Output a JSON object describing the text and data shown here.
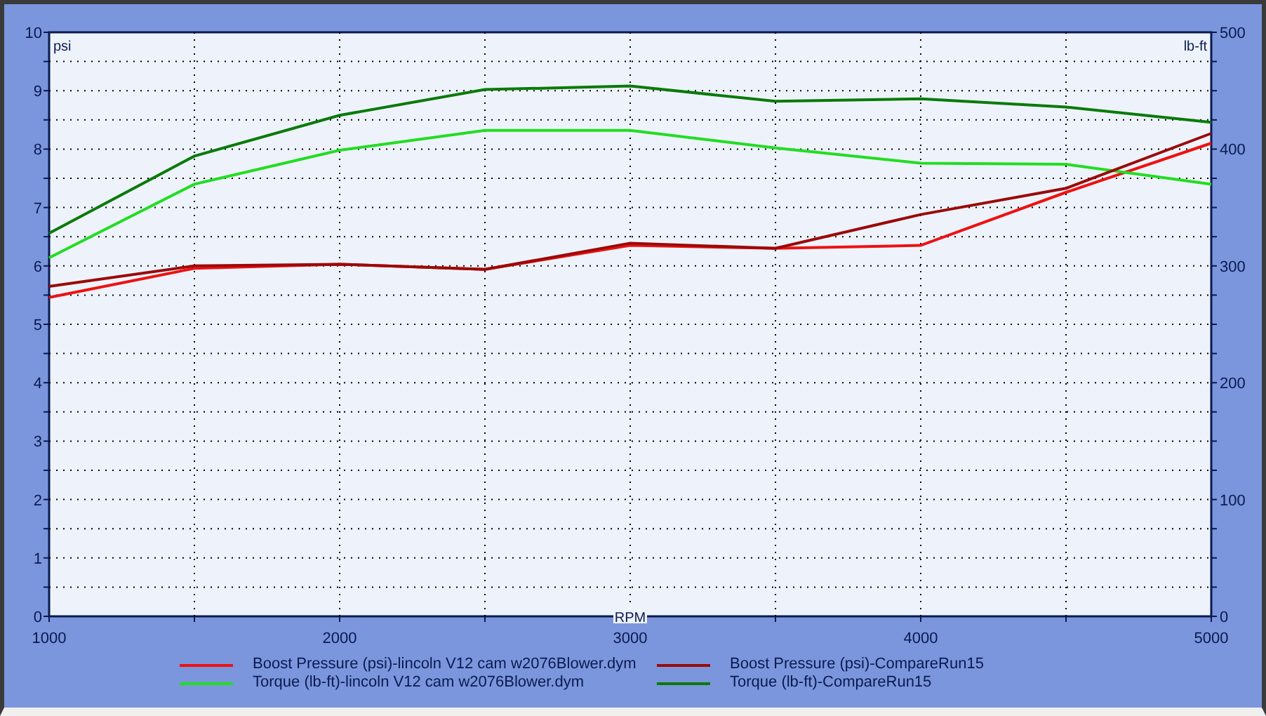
{
  "chart": {
    "chart_data": {
      "type": "line",
      "grid": true,
      "xlabel": "RPM",
      "ylabel": "psi",
      "y2label": "lb-ft",
      "x": [
        1000,
        1500,
        2000,
        2500,
        3000,
        3500,
        4000,
        4500,
        5000
      ],
      "xlim": [
        1000,
        5000
      ],
      "ylim": [
        0,
        10
      ],
      "y2lim": [
        0,
        500
      ],
      "xticks": [
        1000,
        2000,
        3000,
        4000,
        5000
      ],
      "yticks": [
        0,
        1,
        2,
        3,
        4,
        5,
        6,
        7,
        8,
        9,
        10
      ],
      "y2ticks": [
        0,
        100,
        200,
        300,
        400,
        500
      ],
      "series": [
        {
          "name": "Boost Pressure (psi)-lincoln V12 cam w2076Blower.dym",
          "color": "#ee1111",
          "values": [
            5.46,
            5.96,
            6.03,
            5.94,
            6.35,
            6.3,
            6.35,
            7.26,
            8.1
          ]
        },
        {
          "name": "Torque (lb-ft)-lincoln V12 cam w2076Blower.dym",
          "color": "#22dd22",
          "axis": "y2",
          "values": [
            307,
            370,
            399,
            416,
            416,
            401,
            388,
            387,
            370
          ]
        },
        {
          "name": "Boost Pressure (psi)-CompareRun15",
          "color": "#9b0a0a",
          "values": [
            5.65,
            6.0,
            6.03,
            5.94,
            6.39,
            6.3,
            6.88,
            7.33,
            8.27
          ]
        },
        {
          "name": "Torque (lb-ft)-CompareRun15",
          "color": "#0a7a0a",
          "axis": "y2",
          "values": [
            328,
            394,
            429,
            451,
            454,
            441,
            443,
            436,
            423
          ]
        }
      ]
    }
  }
}
